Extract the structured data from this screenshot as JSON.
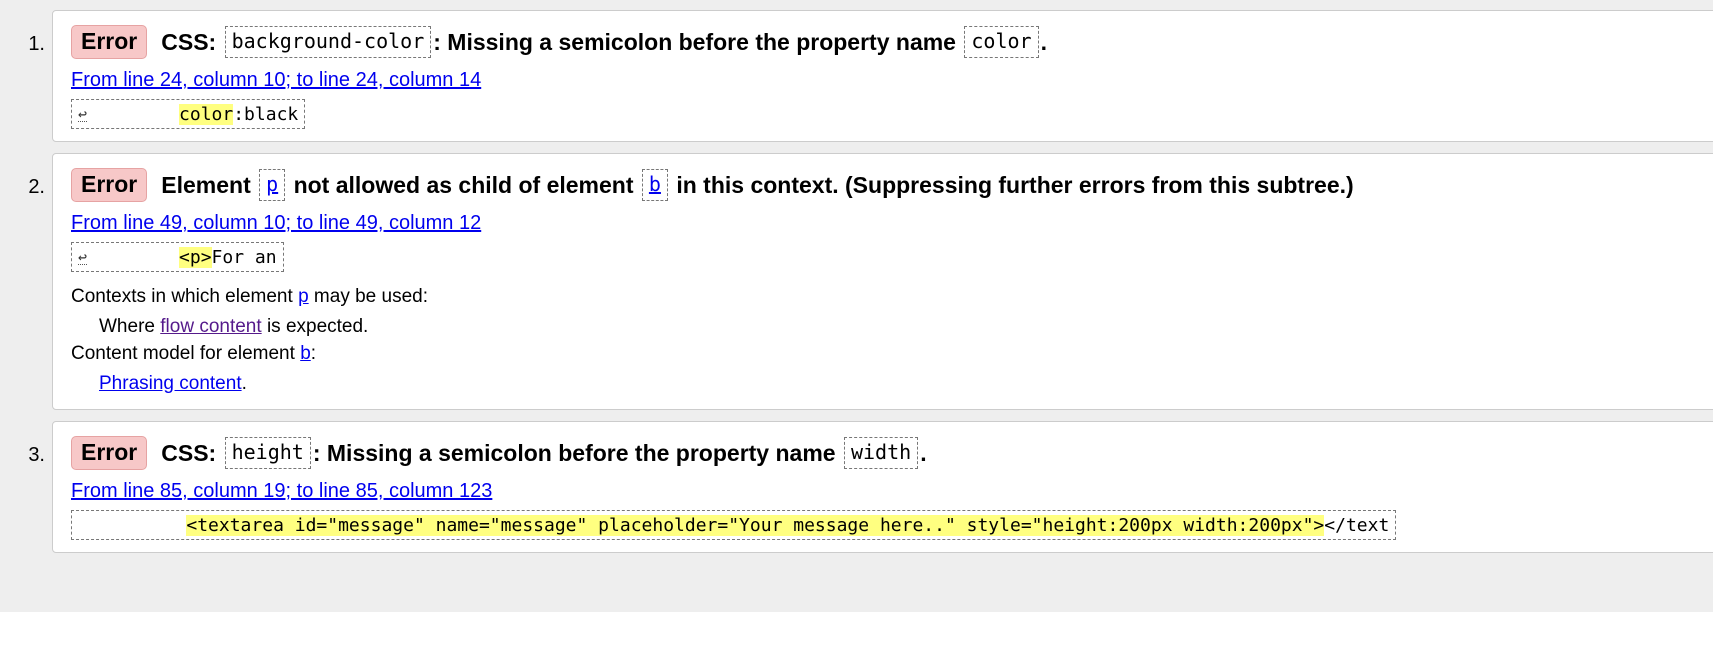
{
  "messages": [
    {
      "number": "1.",
      "badge": "Error",
      "title": {
        "prefix": "CSS:",
        "code1": "background-color",
        "middle": ": Missing a semicolon before the property name",
        "code2": "color",
        "suffix": "."
      },
      "location": "From line 24, column 10; to line 24, column 14",
      "extract": {
        "lf_symbol": "↩",
        "highlight": "color",
        "after": ":black"
      }
    },
    {
      "number": "2.",
      "badge": "Error",
      "title": {
        "prefix": "Element",
        "code1": "p",
        "middle": "not allowed as child of element",
        "code2": "b",
        "suffix": "in this context. (Suppressing further errors from this subtree.)"
      },
      "location": "From line 49, column 10; to line 49, column 12",
      "extract": {
        "lf_symbol": "↩",
        "highlight": "<p>",
        "after": "For an"
      },
      "details": {
        "contexts_label_before": "Contexts in which element",
        "contexts_element": "p",
        "contexts_label_after": "may be used:",
        "contexts_where_before": "Where",
        "contexts_where_link": "flow content",
        "contexts_where_after": "is expected.",
        "model_label_before": "Content model for element",
        "model_element": "b",
        "model_label_after": ":",
        "model_link": "Phrasing content",
        "model_after": "."
      }
    },
    {
      "number": "3.",
      "badge": "Error",
      "title": {
        "prefix": "CSS:",
        "code1": "height",
        "middle": ": Missing a semicolon before the property name",
        "code2": "width",
        "suffix": "."
      },
      "location": "From line 85, column 19; to line 85, column 123",
      "extract": {
        "before": "          ",
        "highlight": "<textarea id=\"message\" name=\"message\" placeholder=\"Your message here..\" style=\"height:200px width:200px\">",
        "after": "</text"
      }
    }
  ],
  "colors": {
    "page_background": "#eeeeee",
    "error_badge": "#f7c8c8",
    "highlight": "#ffff80",
    "link": "#0000ee",
    "visited_link": "#551a8b"
  }
}
